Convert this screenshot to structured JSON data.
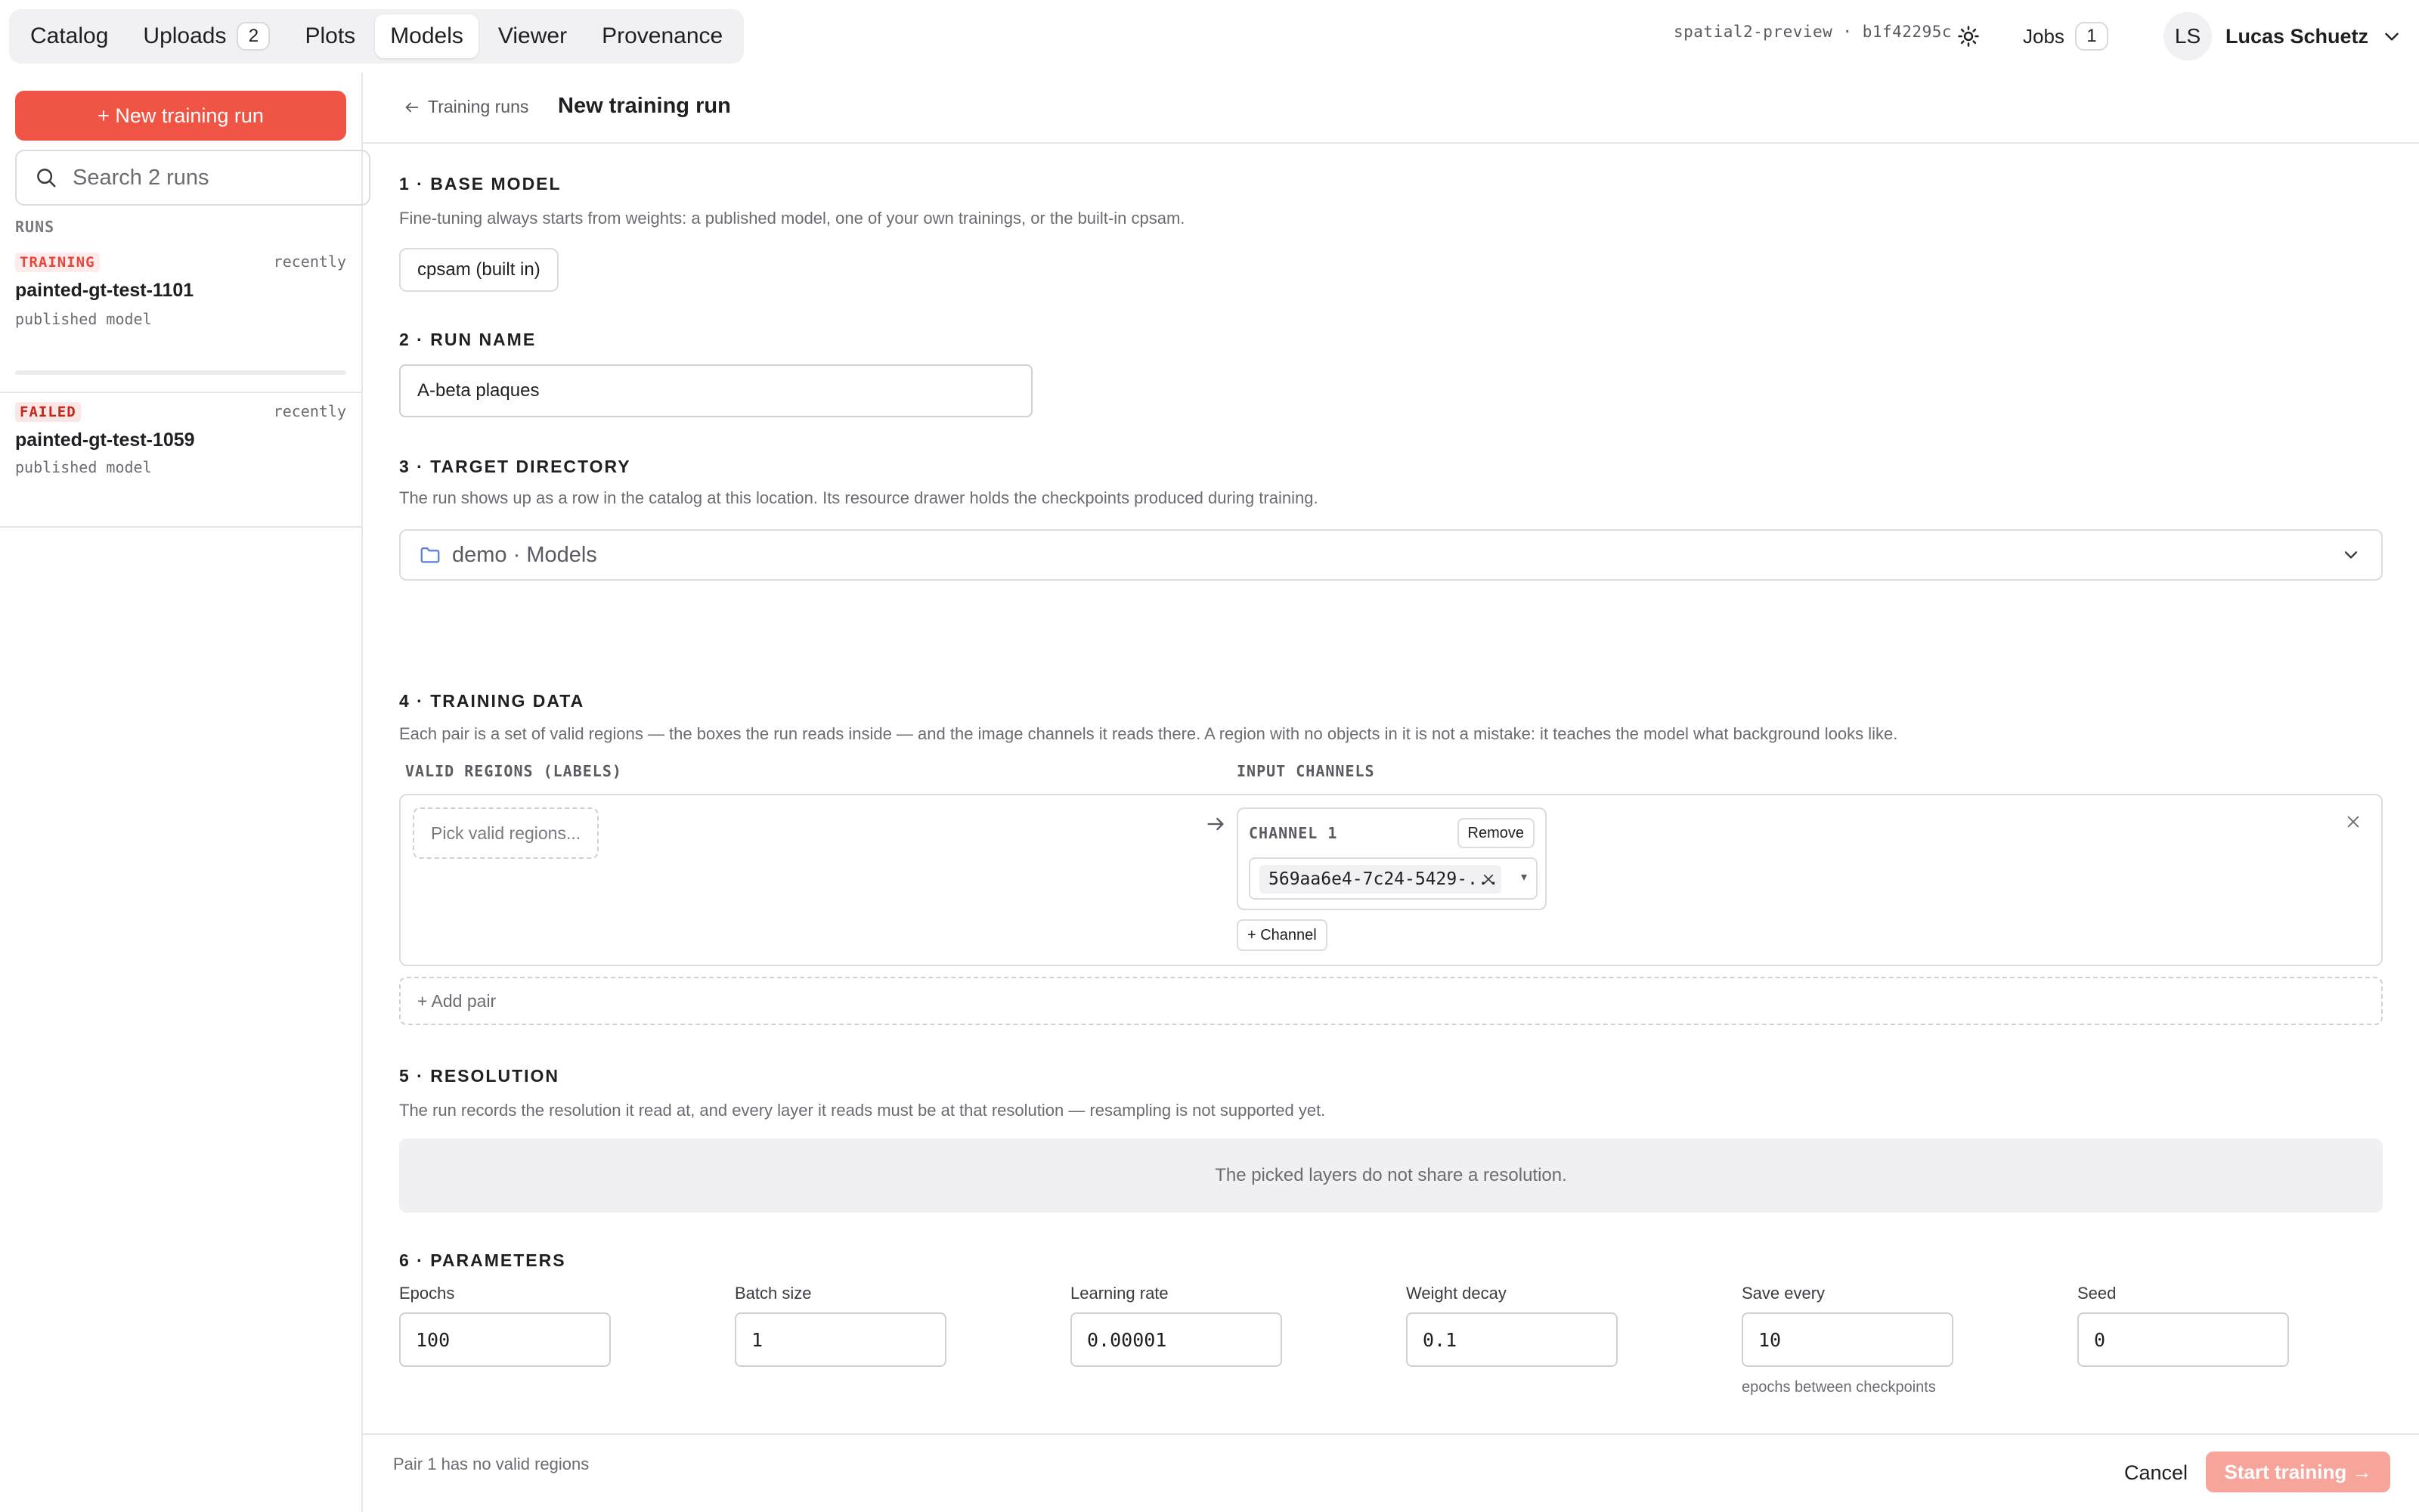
{
  "nav": {
    "items": [
      {
        "label": "Catalog"
      },
      {
        "label": "Uploads",
        "badge": "2"
      },
      {
        "label": "Plots"
      },
      {
        "label": "Models",
        "active": true
      },
      {
        "label": "Viewer"
      },
      {
        "label": "Provenance"
      }
    ]
  },
  "header": {
    "build": "spatial2-preview · b1f42295c",
    "jobs_label": "Jobs",
    "jobs_count": "1",
    "user_initials": "LS",
    "user_name": "Lucas Schuetz"
  },
  "sidebar": {
    "new_run_label": "+ New training run",
    "search_placeholder": "Search 2 runs",
    "runs_label": "RUNS",
    "runs": [
      {
        "status": "TRAINING",
        "time": "recently",
        "name": "painted-gt-test-1101",
        "sub": "published model"
      },
      {
        "status": "FAILED",
        "time": "recently",
        "name": "painted-gt-test-1059",
        "sub": "published model"
      }
    ]
  },
  "subheader": {
    "back_label": "Training runs",
    "title": "New training run"
  },
  "sections": {
    "base_model": {
      "title": "1 · BASE MODEL",
      "desc": "Fine-tuning always starts from weights: a published model, one of your own trainings, or the built-in cpsam.",
      "selected": "cpsam (built in)"
    },
    "run_name": {
      "title": "2 · RUN NAME",
      "value": "A-beta plaques"
    },
    "target_dir": {
      "title": "3 · TARGET DIRECTORY",
      "desc": "The run shows up as a row in the catalog at this location. Its resource drawer holds the checkpoints produced during training.",
      "value": "demo · Models"
    },
    "training_data": {
      "title": "4 · TRAINING DATA",
      "desc": "Each pair is a set of valid regions — the boxes the run reads inside — and the image channels it reads there. A region with no objects in it is not a mistake: it teaches the model what background looks like.",
      "regions_header": "VALID REGIONS (LABELS)",
      "channels_header": "INPUT CHANNELS",
      "pick_placeholder": "Pick valid regions...",
      "channel_label": "CHANNEL 1",
      "remove_label": "Remove",
      "channel_value": "569aa6e4-7c24-5429-...",
      "add_channel_label": "+ Channel",
      "add_pair_label": "+ Add pair"
    },
    "resolution": {
      "title": "5 · RESOLUTION",
      "desc": "The run records the resolution it read at, and every layer it reads must be at that resolution — resampling is not supported yet.",
      "note": "The picked layers do not share a resolution."
    },
    "parameters": {
      "title": "6 · PARAMETERS",
      "epochs_label": "Epochs",
      "epochs_value": "100",
      "batch_label": "Batch size",
      "batch_value": "1",
      "lr_label": "Learning rate",
      "lr_value": "0.00001",
      "wd_label": "Weight decay",
      "wd_value": "0.1",
      "save_label": "Save every",
      "save_value": "10",
      "save_hint": "epochs between checkpoints",
      "seed_label": "Seed",
      "seed_value": "0"
    }
  },
  "footer": {
    "message": "Pair 1 has no valid regions",
    "cancel_label": "Cancel",
    "start_label": "Start training →"
  },
  "colors": {
    "accent": "#f05444",
    "accent_disabled": "#f7a49b",
    "training_status": "#e8463a",
    "failed_status": "#c9231a"
  },
  "icons": [
    "sun-icon",
    "chevron-down-icon",
    "search-icon",
    "arrow-left-icon",
    "folder-icon",
    "arrow-right-icon",
    "close-icon",
    "caret-down-icon"
  ]
}
